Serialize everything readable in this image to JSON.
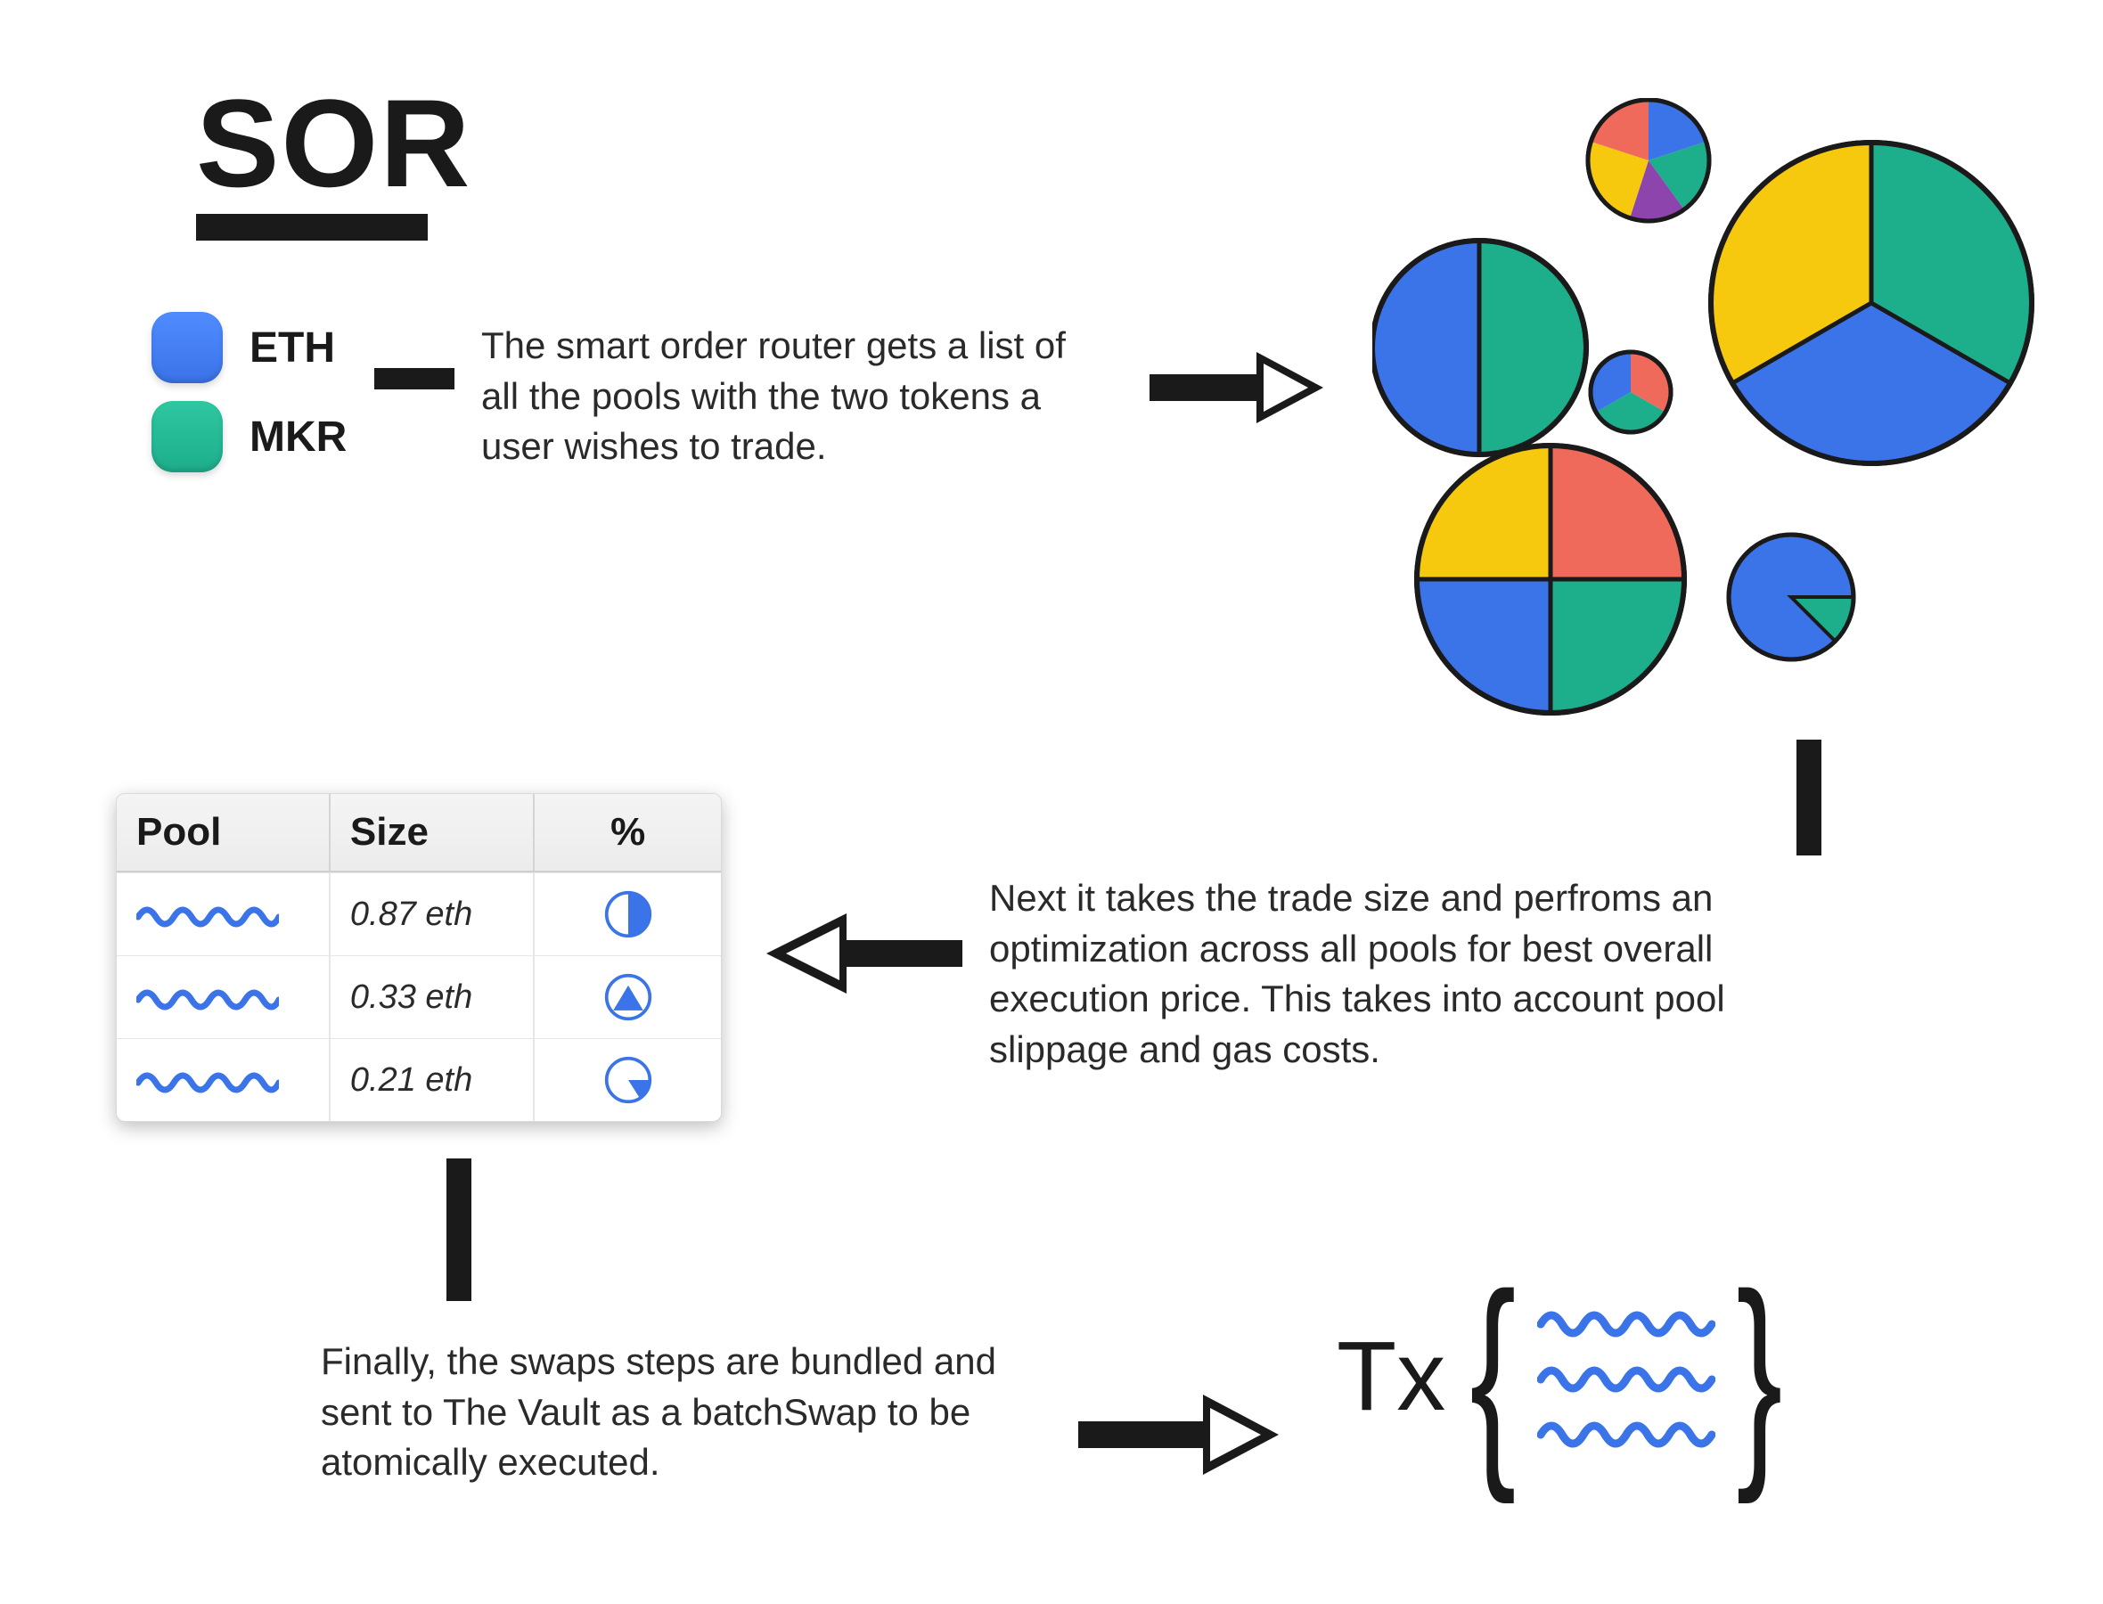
{
  "title": "SOR",
  "tokens": [
    {
      "symbol": "ETH",
      "color": "#3b73e8"
    },
    {
      "symbol": "MKR",
      "color": "#1dae8c"
    }
  ],
  "steps": {
    "step1": "The smart order router gets a list of all the pools with the two tokens a user wishes to trade.",
    "step2": "Next it takes the trade size and perfroms an optimization across all pools for best overall execution price. This takes into account pool slippage and gas costs.",
    "step3": "Finally, the swaps steps are bundled and sent to The Vault as a batchSwap to be atomically executed."
  },
  "table": {
    "headers": {
      "pool": "Pool",
      "size": "Size",
      "pct": "%"
    },
    "rows": [
      {
        "size": "0.87 eth",
        "pct_kind": "half"
      },
      {
        "size": "0.33 eth",
        "pct_kind": "triangle"
      },
      {
        "size": "0.21 eth",
        "pct_kind": "wedge"
      }
    ]
  },
  "tx_label": "Tx",
  "colors": {
    "blue": "#3b73e8",
    "green": "#1dae8c",
    "yellow": "#f6c90e",
    "red": "#ef6a5a",
    "purple": "#8e44ad",
    "stroke": "#1a1a1a"
  },
  "chart_data": [
    {
      "type": "pie",
      "title": "pool-small-top",
      "categories": [
        "red",
        "blue",
        "green",
        "yellow",
        "purple"
      ],
      "values": [
        20,
        25,
        20,
        20,
        15
      ]
    },
    {
      "type": "pie",
      "title": "pool-large-right",
      "categories": [
        "yellow",
        "green",
        "blue"
      ],
      "values": [
        33,
        34,
        33
      ]
    },
    {
      "type": "pie",
      "title": "pool-mid-left",
      "categories": [
        "blue",
        "green"
      ],
      "values": [
        50,
        50
      ]
    },
    {
      "type": "pie",
      "title": "pool-tiny-center",
      "categories": [
        "red",
        "blue",
        "green"
      ],
      "values": [
        33,
        34,
        33
      ]
    },
    {
      "type": "pie",
      "title": "pool-large-bottom-left",
      "categories": [
        "yellow",
        "red",
        "green",
        "blue"
      ],
      "values": [
        25,
        25,
        25,
        25
      ]
    },
    {
      "type": "pie",
      "title": "pool-small-bottom-right",
      "categories": [
        "blue",
        "green"
      ],
      "values": [
        85,
        15
      ]
    },
    {
      "type": "pie",
      "title": "table-row-1-pct",
      "categories": [
        "filled",
        "empty"
      ],
      "values": [
        50,
        50
      ]
    },
    {
      "type": "pie",
      "title": "table-row-2-pct",
      "categories": [
        "filled",
        "empty"
      ],
      "values": [
        30,
        70
      ]
    },
    {
      "type": "pie",
      "title": "table-row-3-pct",
      "categories": [
        "filled",
        "empty"
      ],
      "values": [
        15,
        85
      ]
    }
  ]
}
